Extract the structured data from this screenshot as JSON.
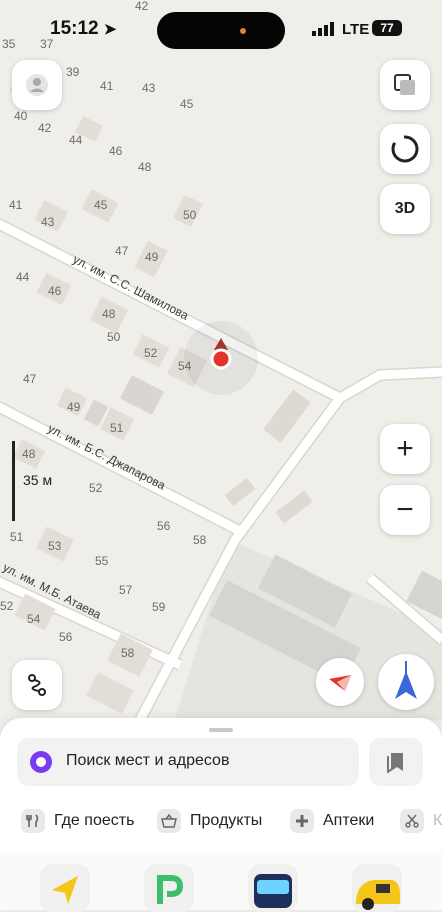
{
  "status_bar": {
    "time": "15:12",
    "network": "LTE",
    "battery": "77"
  },
  "map": {
    "streets": [
      "ул. им. С.С. Шамилова",
      "ул. им. Б.С. Джапарова",
      "ул. им. М.Б. Атаева"
    ],
    "house_numbers": [
      "42",
      "35",
      "37",
      "39",
      "41",
      "43",
      "45",
      "40",
      "42",
      "44",
      "46",
      "48",
      "41",
      "43",
      "45",
      "50",
      "47",
      "49",
      "44",
      "46",
      "48",
      "50",
      "52",
      "54",
      "47",
      "49",
      "51",
      "48",
      "52",
      "56",
      "58",
      "51",
      "53",
      "55",
      "57",
      "59",
      "52",
      "54",
      "56",
      "58"
    ],
    "scale_label": "35 м"
  },
  "controls": {
    "three_d_label": "3D",
    "zoom_in_label": "+",
    "zoom_out_label": "−"
  },
  "bottom_sheet": {
    "search_placeholder": "Поиск мест и адресов",
    "categories": [
      {
        "label": "Где поесть",
        "icon": "fork-knife-icon"
      },
      {
        "label": "Продукты",
        "icon": "basket-icon"
      },
      {
        "label": "Аптеки",
        "icon": "pharmacy-cross-icon"
      },
      {
        "label": "К",
        "icon": "scissors-icon"
      }
    ]
  },
  "tabs": [
    {
      "name": "navigator-tab",
      "icon": "navigator-arrow-icon"
    },
    {
      "name": "parking-tab",
      "icon": "parking-icon"
    },
    {
      "name": "transit-tab",
      "icon": "bus-icon"
    },
    {
      "name": "taxi-tab",
      "icon": "taxi-icon"
    }
  ],
  "colors": {
    "map_background": "#efeee9",
    "road": "#ffffff",
    "building": "#e0dbd4",
    "location_marker": "#e5332a",
    "compass_blue": "#3b67d9",
    "alice_purple": "#7a3cf0"
  }
}
